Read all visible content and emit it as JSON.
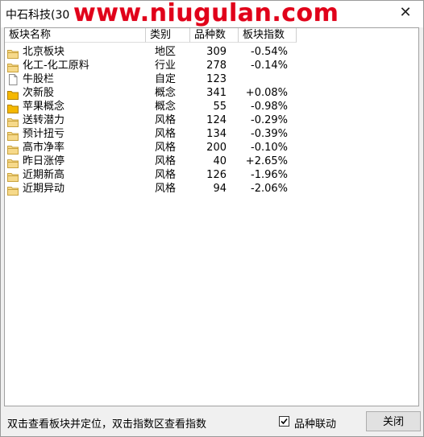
{
  "window": {
    "title": "中石科技(30",
    "watermark": "www.niugulan.com",
    "close_glyph": "✕"
  },
  "columns": [
    "板块名称",
    "类别",
    "品种数",
    "板块指数"
  ],
  "rows": [
    {
      "name": "北京板块",
      "type": "地区",
      "count": "309",
      "index": "-0.54%",
      "icon": "folder-icon"
    },
    {
      "name": "化工-化工原料",
      "type": "行业",
      "count": "278",
      "index": "-0.14%",
      "icon": "folder-icon"
    },
    {
      "name": "牛股栏",
      "type": "自定",
      "count": "123",
      "index": "",
      "icon": "document-icon"
    },
    {
      "name": "次新股",
      "type": "概念",
      "count": "341",
      "index": "+0.08%",
      "icon": "folder-filled-icon"
    },
    {
      "name": "苹果概念",
      "type": "概念",
      "count": "55",
      "index": "-0.98%",
      "icon": "folder-filled-icon"
    },
    {
      "name": "送转潜力",
      "type": "风格",
      "count": "124",
      "index": "-0.29%",
      "icon": "folder-icon"
    },
    {
      "name": "预计扭亏",
      "type": "风格",
      "count": "134",
      "index": "-0.39%",
      "icon": "folder-icon"
    },
    {
      "name": "高市净率",
      "type": "风格",
      "count": "200",
      "index": "-0.10%",
      "icon": "folder-icon"
    },
    {
      "name": "昨日涨停",
      "type": "风格",
      "count": "40",
      "index": "+2.65%",
      "icon": "folder-icon"
    },
    {
      "name": "近期新高",
      "type": "风格",
      "count": "126",
      "index": "-1.96%",
      "icon": "folder-icon"
    },
    {
      "name": "近期异动",
      "type": "风格",
      "count": "94",
      "index": "-2.06%",
      "icon": "folder-icon"
    }
  ],
  "statusbar": {
    "hint": "双击查看板块并定位，双击指数区查看指数",
    "checkbox_label": "品种联动",
    "checkbox_checked": true,
    "check_glyph": "✓",
    "close_label": "关闭"
  },
  "colors": {
    "folder_fill": "#f6d98a",
    "folder_stroke": "#c9a23c",
    "folder_filled": "#f5b800",
    "watermark": "#e0001a"
  }
}
